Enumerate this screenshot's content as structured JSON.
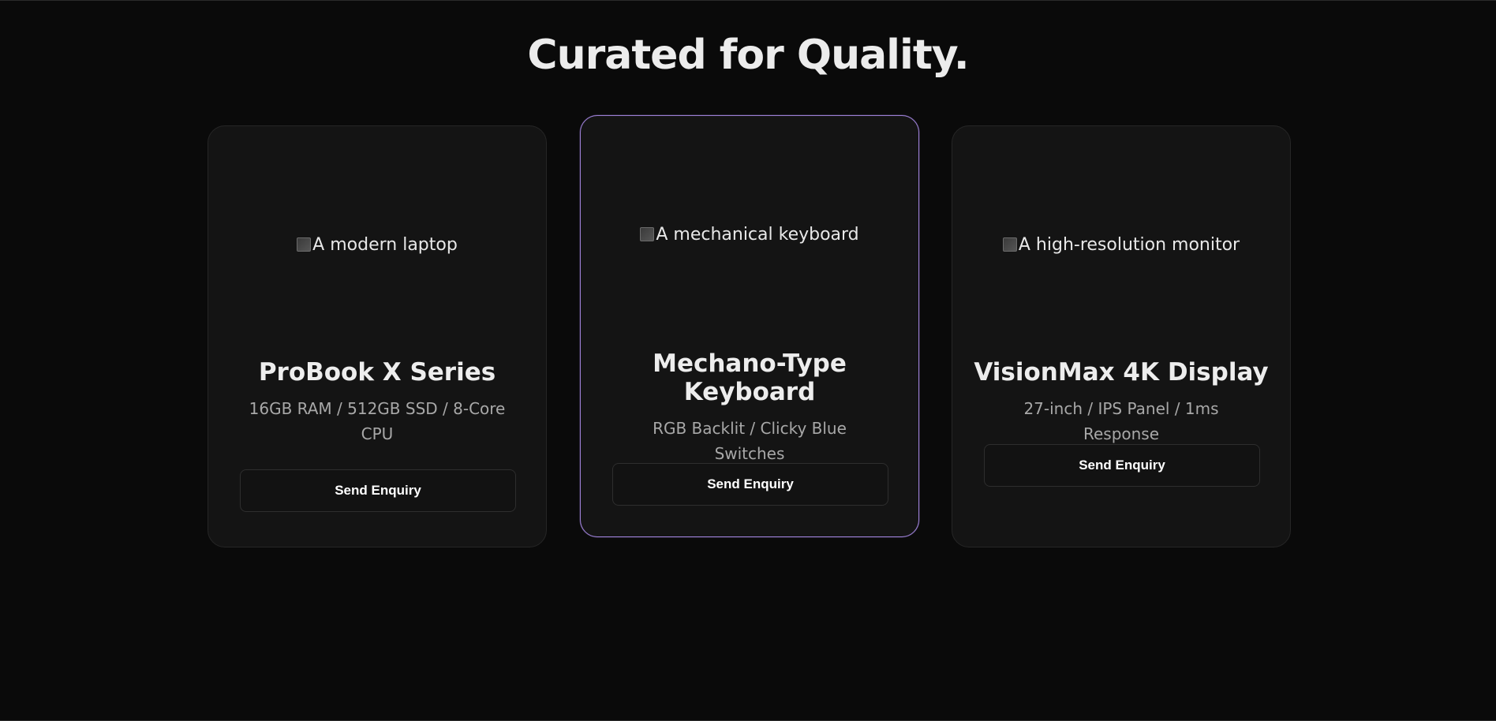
{
  "section": {
    "title": "Curated for Quality."
  },
  "products": [
    {
      "image_alt": "A modern laptop",
      "name": "ProBook X Series",
      "specs": "16GB RAM / 512GB SSD / 8-Core CPU",
      "button_label": "Send Enquiry"
    },
    {
      "image_alt": "A mechanical keyboard",
      "name": "Mechano-Type Keyboard",
      "specs": "RGB Backlit / Clicky Blue Switches",
      "button_label": "Send Enquiry"
    },
    {
      "image_alt": "A high-resolution monitor",
      "name": "VisionMax 4K Display",
      "specs": "27-inch / IPS Panel / 1ms Response",
      "button_label": "Send Enquiry"
    }
  ],
  "icons": {
    "broken_image": "broken-image-icon"
  },
  "colors": {
    "background": "#0a0a0a",
    "card": "#141414",
    "featured_border": "#9b7fd4",
    "text": "#ededed",
    "muted_text": "#a8a8a8"
  }
}
